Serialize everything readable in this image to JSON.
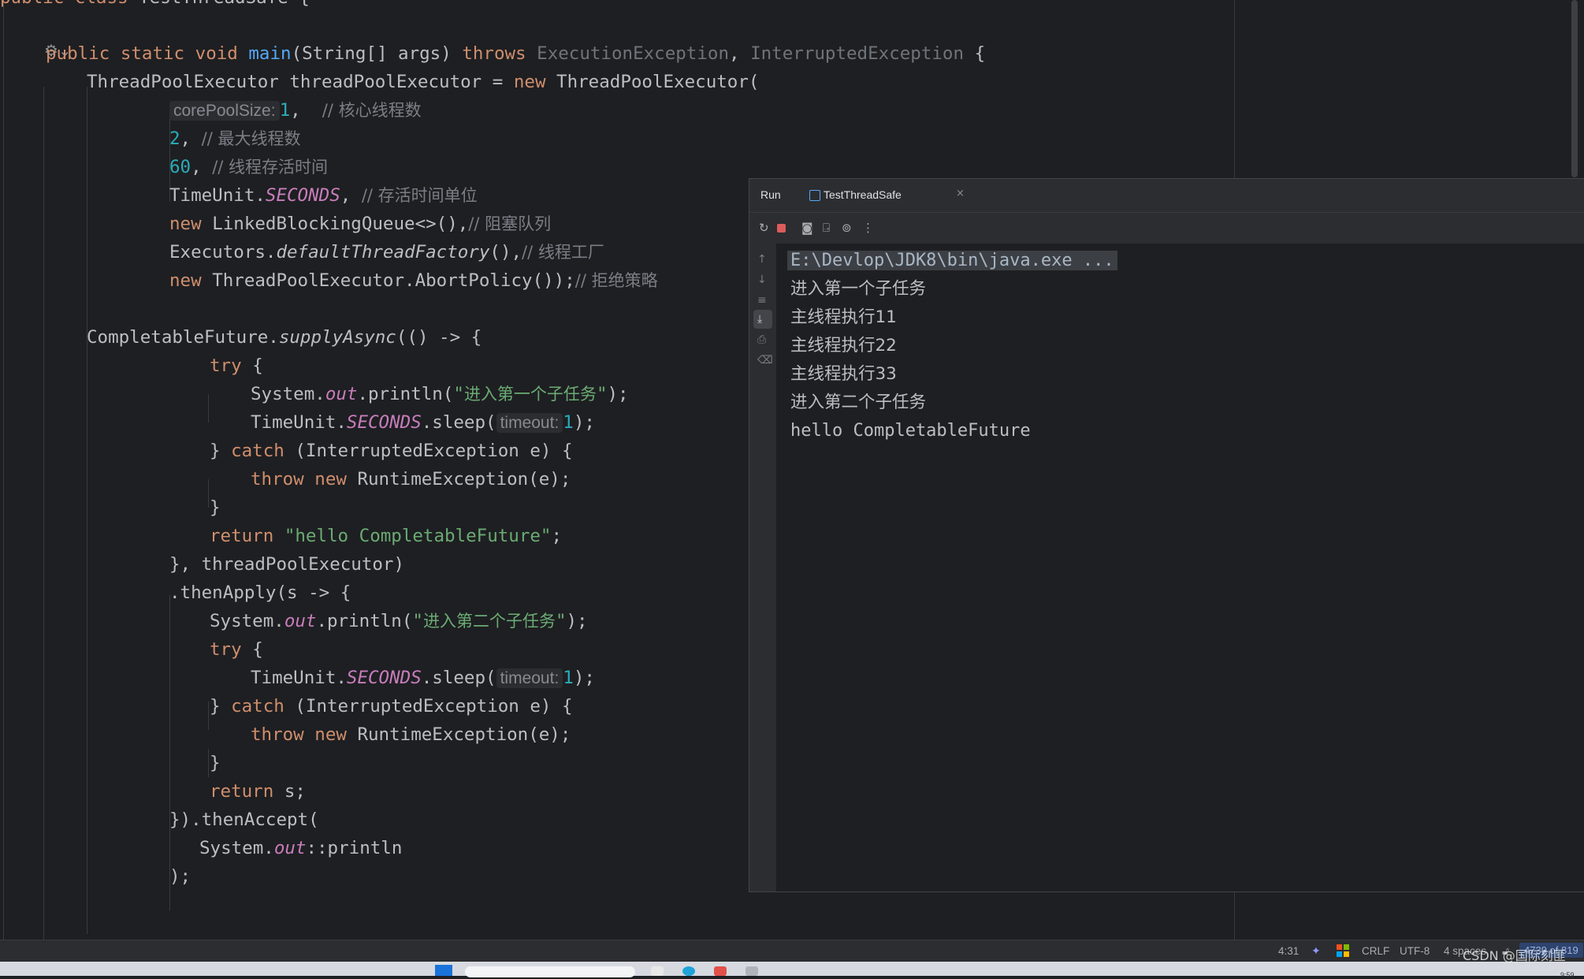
{
  "editor": {
    "lines": [
      [
        {
          "t": "public class ",
          "c": "kw"
        },
        {
          "t": "TestThreadSafe {",
          "c": "n"
        }
      ],
      [
        {
          "t": "public static void ",
          "c": "kw"
        },
        {
          "t": "main",
          "c": "fn"
        },
        {
          "t": "(String[] args) ",
          "c": "n"
        },
        {
          "t": "throws ",
          "c": "kw"
        },
        {
          "t": "ExecutionException",
          "c": "type"
        },
        {
          "t": ", ",
          "c": "n"
        },
        {
          "t": "InterruptedException",
          "c": "type"
        },
        {
          "t": " {",
          "c": "n"
        }
      ],
      [
        {
          "t": "ThreadPoolExecutor threadPoolExecutor = ",
          "c": "n"
        },
        {
          "t": "new ",
          "c": "kw"
        },
        {
          "t": "ThreadPoolExecutor(",
          "c": "n"
        }
      ],
      [
        {
          "t": "corePoolSize:",
          "c": "hint"
        },
        {
          "t": "1",
          "c": "num"
        },
        {
          "t": ",  ",
          "c": "n"
        },
        {
          "t": "// 核心线程数",
          "c": "cm"
        }
      ],
      [
        {
          "t": "2",
          "c": "num"
        },
        {
          "t": ", ",
          "c": "n"
        },
        {
          "t": "// 最大线程数",
          "c": "cm"
        }
      ],
      [
        {
          "t": "60",
          "c": "num"
        },
        {
          "t": ", ",
          "c": "n"
        },
        {
          "t": "// 线程存活时间",
          "c": "cm"
        }
      ],
      [
        {
          "t": "TimeUnit.",
          "c": "n"
        },
        {
          "t": "SECONDS",
          "c": "field"
        },
        {
          "t": ", ",
          "c": "n"
        },
        {
          "t": "// 存活时间单位",
          "c": "cm"
        }
      ],
      [
        {
          "t": "new ",
          "c": "kw"
        },
        {
          "t": "LinkedBlockingQueue<>(),",
          "c": "n"
        },
        {
          "t": "// 阻塞队列",
          "c": "cm"
        }
      ],
      [
        {
          "t": "Executors.",
          "c": "n"
        },
        {
          "t": "defaultThreadFactory",
          "c": "ital"
        },
        {
          "t": "(),",
          "c": "n"
        },
        {
          "t": "// 线程工厂",
          "c": "cm"
        }
      ],
      [
        {
          "t": "new ",
          "c": "kw"
        },
        {
          "t": "ThreadPoolExecutor.AbortPolicy());",
          "c": "n"
        },
        {
          "t": "// 拒绝策略",
          "c": "cm"
        }
      ],
      [
        {
          "t": "CompletableFuture.",
          "c": "n"
        },
        {
          "t": "supplyAsync",
          "c": "ital"
        },
        {
          "t": "(() -> {",
          "c": "n"
        }
      ],
      [
        {
          "t": "try ",
          "c": "kw"
        },
        {
          "t": "{",
          "c": "n"
        }
      ],
      [
        {
          "t": "System.",
          "c": "n"
        },
        {
          "t": "out",
          "c": "field"
        },
        {
          "t": ".println(",
          "c": "n"
        },
        {
          "t": "\"",
          "c": "st"
        },
        {
          "t": "进入第一个子任务",
          "c": "stcn"
        },
        {
          "t": "\"",
          "c": "st"
        },
        {
          "t": ");",
          "c": "n"
        }
      ],
      [
        {
          "t": "TimeUnit.",
          "c": "n"
        },
        {
          "t": "SECONDS",
          "c": "field"
        },
        {
          "t": ".sleep(",
          "c": "n"
        },
        {
          "t": "timeout:",
          "c": "hint"
        },
        {
          "t": "1",
          "c": "num"
        },
        {
          "t": ");",
          "c": "n"
        }
      ],
      [
        {
          "t": "} ",
          "c": "n"
        },
        {
          "t": "catch ",
          "c": "kw"
        },
        {
          "t": "(InterruptedException e) {",
          "c": "n"
        }
      ],
      [
        {
          "t": "throw new ",
          "c": "kw"
        },
        {
          "t": "RuntimeException(e);",
          "c": "n"
        }
      ],
      [
        {
          "t": "}",
          "c": "n"
        }
      ],
      [
        {
          "t": "return ",
          "c": "kw"
        },
        {
          "t": "\"hello CompletableFuture\"",
          "c": "st"
        },
        {
          "t": ";",
          "c": "n"
        }
      ],
      [
        {
          "t": "}, threadPoolExecutor)",
          "c": "n"
        }
      ],
      [
        {
          "t": ".thenApply(s -> {",
          "c": "n"
        }
      ],
      [
        {
          "t": "System.",
          "c": "n"
        },
        {
          "t": "out",
          "c": "field"
        },
        {
          "t": ".println(",
          "c": "n"
        },
        {
          "t": "\"",
          "c": "st"
        },
        {
          "t": "进入第二个子任务",
          "c": "stcn"
        },
        {
          "t": "\"",
          "c": "st"
        },
        {
          "t": ");",
          "c": "n"
        }
      ],
      [
        {
          "t": "try ",
          "c": "kw"
        },
        {
          "t": "{",
          "c": "n"
        }
      ],
      [
        {
          "t": "TimeUnit.",
          "c": "n"
        },
        {
          "t": "SECONDS",
          "c": "field"
        },
        {
          "t": ".sleep(",
          "c": "n"
        },
        {
          "t": "timeout:",
          "c": "hint"
        },
        {
          "t": "1",
          "c": "num"
        },
        {
          "t": ");",
          "c": "n"
        }
      ],
      [
        {
          "t": "} ",
          "c": "n"
        },
        {
          "t": "catch ",
          "c": "kw"
        },
        {
          "t": "(InterruptedException e) {",
          "c": "n"
        }
      ],
      [
        {
          "t": "throw new ",
          "c": "kw"
        },
        {
          "t": "RuntimeException(e);",
          "c": "n"
        }
      ],
      [
        {
          "t": "}",
          "c": "n"
        }
      ],
      [
        {
          "t": "return ",
          "c": "kw"
        },
        {
          "t": "s;",
          "c": "n"
        }
      ],
      [
        {
          "t": "}).thenAccept(",
          "c": "n"
        }
      ],
      [
        {
          "t": "System.",
          "c": "n"
        },
        {
          "t": "out",
          "c": "field"
        },
        {
          "t": "::println",
          "c": "n"
        }
      ],
      [
        {
          "t": ");",
          "c": "n"
        }
      ]
    ]
  },
  "run_panel": {
    "label": "Run",
    "tab_title": "TestThreadSafe",
    "close_glyph": "×",
    "output": [
      {
        "text": "E:\\Devlop\\JDK8\\bin\\java.exe ...",
        "kind": "cmd"
      },
      {
        "text": "进入第一个子任务",
        "kind": "cn"
      },
      {
        "text": "主线程执行11",
        "kind": "cn"
      },
      {
        "text": "主线程执行22",
        "kind": "cn"
      },
      {
        "text": "主线程执行33",
        "kind": "cn"
      },
      {
        "text": "进入第二个子任务",
        "kind": "cn"
      },
      {
        "text": "hello CompletableFuture",
        "kind": "plain"
      }
    ],
    "toolbar_icons": [
      "rerun-icon",
      "stop-icon",
      "camera-icon",
      "exit-icon",
      "capture-icon",
      "more-icon"
    ],
    "side_icons": [
      "arrow-up-icon",
      "arrow-down-icon",
      "soft-wrap-icon",
      "scroll-to-end-icon",
      "print-icon",
      "trash-icon"
    ]
  },
  "status_bar": {
    "position": "4:31",
    "line_sep": "CRLF",
    "encoding": "UTF-8",
    "indent": "4 spaces",
    "lines_info": "4739 of 819"
  },
  "watermark": "CSDN @国际刻匪",
  "clock": "9:59",
  "colors": {
    "keyword": "#cf8e6d",
    "function": "#56a8f5",
    "number": "#2aacb8",
    "string": "#6aab73",
    "comment": "#7a7e85",
    "static_field": "#c77dbb",
    "accent": "#3574f0"
  }
}
